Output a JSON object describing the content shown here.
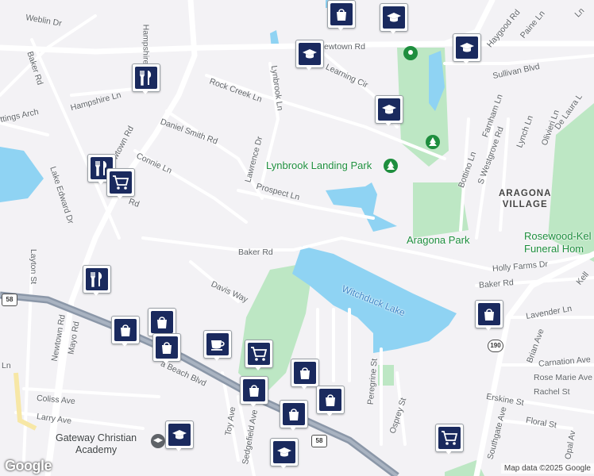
{
  "map": {
    "colors": {
      "water": "#8fd3f3",
      "park": "#bde7c4",
      "road": "#ffffff",
      "highway": "#8b97a8",
      "background": "#f3f2f5",
      "pin": "#1a2a5e"
    },
    "streets": [
      {
        "id": "weblin",
        "text": "Weblin Dr"
      },
      {
        "id": "baker-rd-top",
        "text": "Baker Rd"
      },
      {
        "id": "hampshire-top",
        "text": "Hampshire"
      },
      {
        "id": "hampshire-ln",
        "text": "Hampshire Ln"
      },
      {
        "id": "hastings",
        "text": "ttings Arch"
      },
      {
        "id": "newtown-rd-mid",
        "text": "Newtown Rd"
      },
      {
        "id": "daniel-smith",
        "text": "Daniel Smith Rd"
      },
      {
        "id": "connie",
        "text": "Connie Ln"
      },
      {
        "id": "rd-frag",
        "text": "Rd"
      },
      {
        "id": "lake-edward",
        "text": "Lake Edward Dr"
      },
      {
        "id": "layton",
        "text": "Layton St"
      },
      {
        "id": "newtown-rd-sw",
        "text": "Newtown Rd"
      },
      {
        "id": "mayo",
        "text": "Mayo Rd"
      },
      {
        "id": "coliss",
        "text": "Coliss Ave"
      },
      {
        "id": "larry",
        "text": "Larry Ave"
      },
      {
        "id": "ln-frag",
        "text": "Ln"
      },
      {
        "id": "rock-creek",
        "text": "Rock Creek Ln"
      },
      {
        "id": "lynbrook-ln",
        "text": "Lynbrook Ln"
      },
      {
        "id": "lawrence",
        "text": "Lawrence Dr"
      },
      {
        "id": "prospect",
        "text": "Prospect Ln"
      },
      {
        "id": "baker-rd-mid",
        "text": "Baker Rd"
      },
      {
        "id": "davis-way",
        "text": "Davis Way"
      },
      {
        "id": "beach-blvd",
        "text": "a Beach Blvd"
      },
      {
        "id": "toy-ave",
        "text": "Toy Ave"
      },
      {
        "id": "sedgefield",
        "text": "Sedgefield Ave"
      },
      {
        "id": "newtown-rd-top",
        "text": "ewtown Rd"
      },
      {
        "id": "learning-cir",
        "text": "Learning Cir"
      },
      {
        "id": "haygood",
        "text": "Haygood Rd"
      },
      {
        "id": "paine",
        "text": "Paine Ln"
      },
      {
        "id": "sullivan",
        "text": "Sullivan Blvd"
      },
      {
        "id": "farnham",
        "text": "Farnham Ln"
      },
      {
        "id": "lynch",
        "text": "Lynch Ln"
      },
      {
        "id": "olivieri",
        "text": "Olivieri Ln"
      },
      {
        "id": "de-laura",
        "text": "De Laura L"
      },
      {
        "id": "bottino",
        "text": "Bottino Ln"
      },
      {
        "id": "westgrove",
        "text": "S Westgrove Rd"
      },
      {
        "id": "holly-farms",
        "text": "Holly Farms Dr"
      },
      {
        "id": "baker-rd-east",
        "text": "Baker Rd"
      },
      {
        "id": "kell",
        "text": "Kell"
      },
      {
        "id": "lavender",
        "text": "Lavender Ln"
      },
      {
        "id": "brian",
        "text": "Brian Ave"
      },
      {
        "id": "carnation",
        "text": "Carnation Ave"
      },
      {
        "id": "rose-marie",
        "text": "Rose Marie Ave"
      },
      {
        "id": "rachel",
        "text": "Rachel St"
      },
      {
        "id": "erskine",
        "text": "Erskine St"
      },
      {
        "id": "floral",
        "text": "Floral St"
      },
      {
        "id": "southgate",
        "text": "Southgate Ave"
      },
      {
        "id": "opal",
        "text": "Opal Av"
      },
      {
        "id": "peregrine",
        "text": "Peregrine St"
      },
      {
        "id": "osprey",
        "text": "Osprey St"
      },
      {
        "id": "ln-right",
        "text": "Ln"
      }
    ],
    "places": {
      "lynbrook_park": "Lynbrook Landing Park",
      "aragona_park": "Aragona Park",
      "witchduck_lake": "Witchduck Lake",
      "aragona_village_1": "ARAGONA",
      "aragona_village_2": "VILLAGE",
      "rosewood_1": "Rosewood-Kel",
      "rosewood_2": "Funeral Hom",
      "gateway_1": "Gateway Christian",
      "gateway_2": "Academy"
    },
    "shields": {
      "us58_a": "58",
      "us58_b": "58",
      "sr190": "190"
    },
    "pins": [
      {
        "id": "pin-shop-1",
        "icon": "shopping-bag-icon"
      },
      {
        "id": "pin-school-1",
        "icon": "graduation-cap-icon"
      },
      {
        "id": "pin-school-2",
        "icon": "graduation-cap-icon"
      },
      {
        "id": "pin-school-3",
        "icon": "graduation-cap-icon"
      },
      {
        "id": "pin-school-4",
        "icon": "graduation-cap-icon"
      },
      {
        "id": "pin-food-1",
        "icon": "fork-knife-icon"
      },
      {
        "id": "pin-food-2",
        "icon": "fork-knife-icon"
      },
      {
        "id": "pin-cart-1",
        "icon": "shopping-cart-icon"
      },
      {
        "id": "pin-food-3",
        "icon": "fork-knife-icon"
      },
      {
        "id": "pin-shop-2",
        "icon": "shopping-bag-icon"
      },
      {
        "id": "pin-shop-3",
        "icon": "shopping-bag-icon"
      },
      {
        "id": "pin-shop-4",
        "icon": "shopping-bag-icon"
      },
      {
        "id": "pin-coffee-1",
        "icon": "coffee-cup-icon"
      },
      {
        "id": "pin-cart-2",
        "icon": "shopping-cart-icon"
      },
      {
        "id": "pin-shop-5",
        "icon": "shopping-bag-icon"
      },
      {
        "id": "pin-shop-6",
        "icon": "shopping-bag-icon"
      },
      {
        "id": "pin-shop-7",
        "icon": "shopping-bag-icon"
      },
      {
        "id": "pin-shop-8",
        "icon": "shopping-bag-icon"
      },
      {
        "id": "pin-school-5",
        "icon": "graduation-cap-icon"
      },
      {
        "id": "pin-school-6",
        "icon": "graduation-cap-icon"
      },
      {
        "id": "pin-cart-3",
        "icon": "shopping-cart-icon"
      },
      {
        "id": "pin-shop-9",
        "icon": "shopping-bag-icon"
      }
    ],
    "logo": "Google",
    "attribution": "Map data ©2025 Google"
  }
}
